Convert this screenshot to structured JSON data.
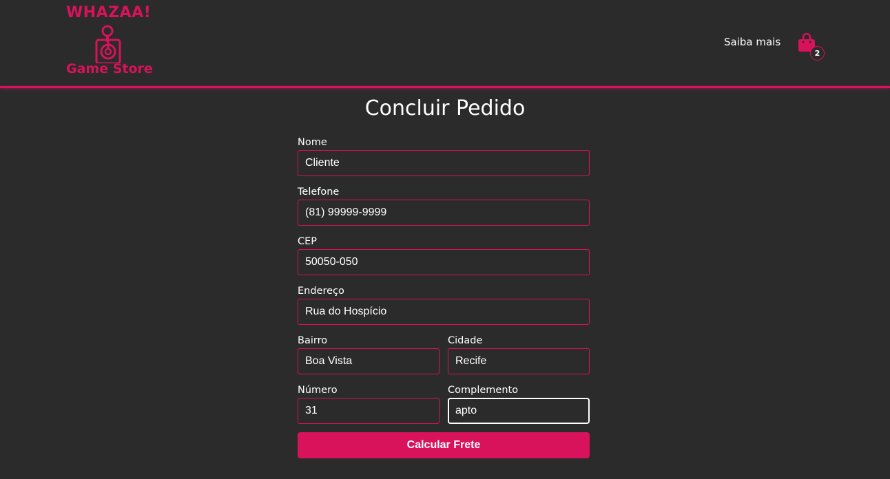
{
  "brand": {
    "logo_top": "WHAZAA!",
    "logo_bottom": "Game Store",
    "accent": "#d8125b",
    "icon": "joystick-icon"
  },
  "nav": {
    "link": "Saiba mais",
    "cart_icon": "shopping-bag-icon",
    "cart_count": "2"
  },
  "page": {
    "title": "Concluir Pedido"
  },
  "form": {
    "nome": {
      "label": "Nome",
      "value": "Cliente"
    },
    "telefone": {
      "label": "Telefone",
      "value": "(81) 99999-9999"
    },
    "cep": {
      "label": "CEP",
      "value": "50050-050"
    },
    "endereco": {
      "label": "Endereço",
      "value": "Rua do Hospício"
    },
    "bairro": {
      "label": "Bairro",
      "value": "Boa Vista"
    },
    "cidade": {
      "label": "Cidade",
      "value": "Recife"
    },
    "numero": {
      "label": "Número",
      "value": "31"
    },
    "complemento": {
      "label": "Complemento",
      "value": "apto"
    },
    "submit_label": "Calcular Frete"
  }
}
